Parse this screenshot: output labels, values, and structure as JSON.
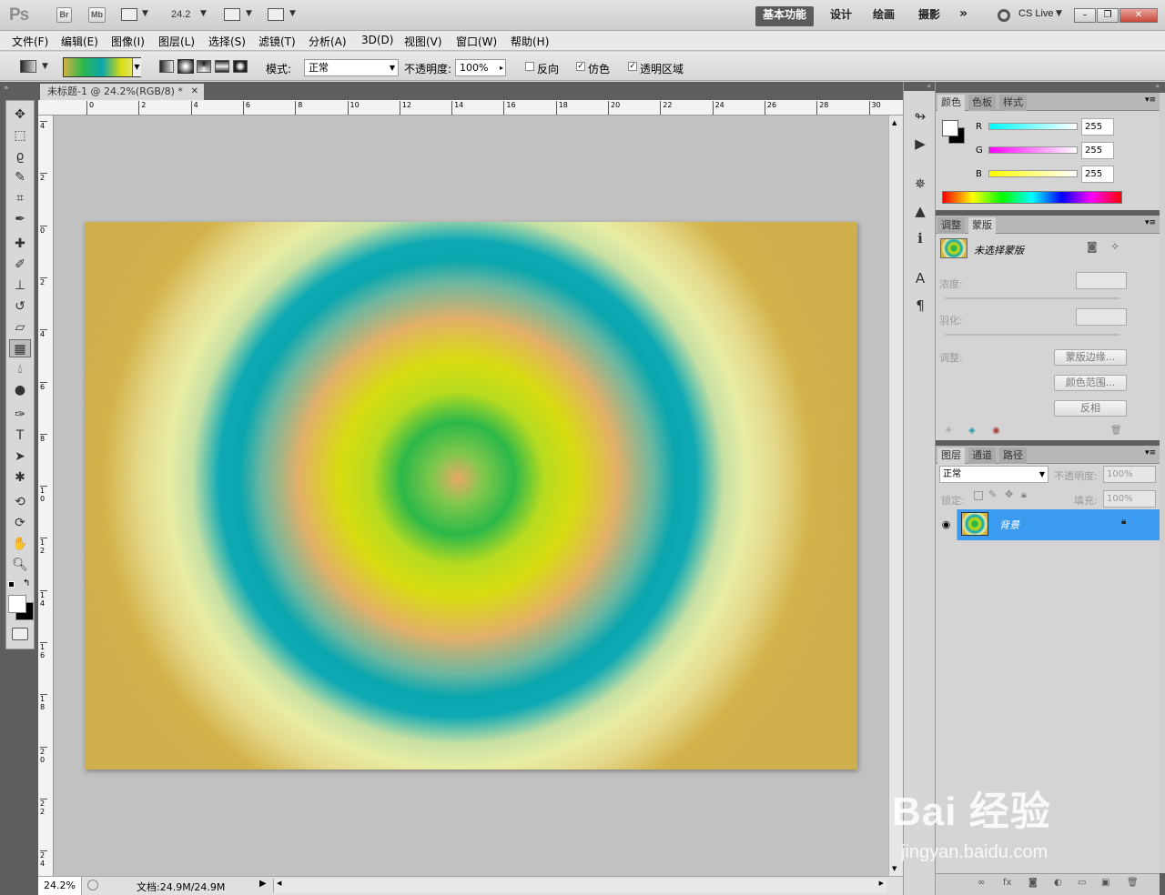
{
  "app": {
    "logo": "Ps",
    "bridge_label": "Br",
    "minibridge_label": "Mb",
    "zoom_value": "24.2",
    "workspaces": [
      "基本功能",
      "设计",
      "绘画",
      "摄影"
    ],
    "more": "»",
    "cslive": "CS Live"
  },
  "menu": [
    "文件(F)",
    "编辑(E)",
    "图像(I)",
    "图层(L)",
    "选择(S)",
    "滤镜(T)",
    "分析(A)",
    "3D(D)",
    "视图(V)",
    "窗口(W)",
    "帮助(H)"
  ],
  "options": {
    "mode_label": "模式:",
    "mode_value": "正常",
    "opacity_label": "不透明度:",
    "opacity_value": "100%",
    "reverse_label": "反向",
    "dither_label": "仿色",
    "transparency_label": "透明区域"
  },
  "document": {
    "tab_title": "未标题-1 @ 24.2%(RGB/8) *",
    "ruler_top": [
      "0",
      "2",
      "4",
      "6",
      "8",
      "10",
      "12",
      "14",
      "16",
      "18",
      "20",
      "22",
      "24",
      "26",
      "28",
      "30"
    ],
    "ruler_left": [
      "4",
      "2",
      "0",
      "2",
      "4",
      "6",
      "8",
      "1 0",
      "1 2",
      "1 4",
      "1 6",
      "1 8",
      "2 0",
      "2 2",
      "2 4"
    ],
    "zoom": "24.2%",
    "doc_size": "文档:24.9M/24.9M"
  },
  "color_panel": {
    "tabs": [
      "颜色",
      "色板",
      "样式"
    ],
    "r_label": "R",
    "g_label": "G",
    "b_label": "B",
    "r_value": "255",
    "g_value": "255",
    "b_value": "255"
  },
  "mask_panel": {
    "tabs": [
      "调整",
      "蒙版"
    ],
    "title": "未选择蒙版",
    "density_label": "浓度:",
    "feather_label": "羽化:",
    "refine_label": "调整:",
    "mask_edge": "蒙版边缘...",
    "color_range": "颜色范围...",
    "invert": "反相"
  },
  "layers_panel": {
    "tabs": [
      "图层",
      "通道",
      "路径"
    ],
    "blend_mode": "正常",
    "opacity_label": "不透明度:",
    "opacity_value": "100%",
    "lock_label": "锁定:",
    "fill_label": "填充:",
    "fill_value": "100%",
    "layer_name": "背景"
  },
  "watermark": {
    "brand": "Bai 经验",
    "url": "jingyan.baidu.com"
  }
}
